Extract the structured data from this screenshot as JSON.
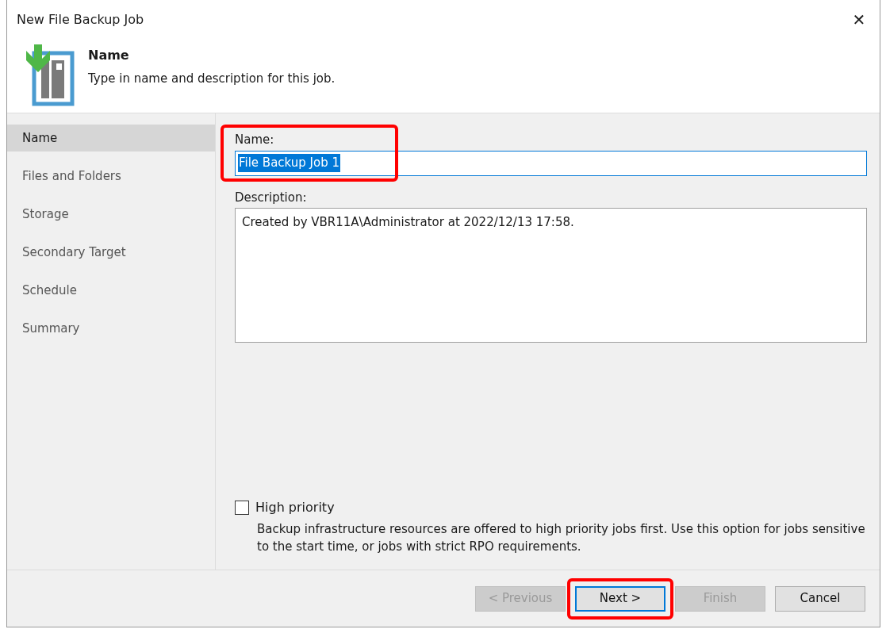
{
  "window": {
    "title": "New File Backup Job",
    "close_glyph": "✕"
  },
  "header": {
    "title": "Name",
    "subtitle": "Type in name and description for this job."
  },
  "steps": [
    {
      "label": "Name",
      "selected": true
    },
    {
      "label": "Files and Folders",
      "selected": false
    },
    {
      "label": "Storage",
      "selected": false
    },
    {
      "label": "Secondary Target",
      "selected": false
    },
    {
      "label": "Schedule",
      "selected": false
    },
    {
      "label": "Summary",
      "selected": false
    }
  ],
  "name_field": {
    "label": "Name:",
    "value": "File Backup Job 1",
    "text_selected": true,
    "highlighted": true
  },
  "description_field": {
    "label": "Description:",
    "value": "Created by VBR11A\\Administrator at 2022/12/13 17:58."
  },
  "high_priority": {
    "label": "High priority",
    "checked": false,
    "note": "Backup infrastructure resources are offered to high priority jobs first. Use this option for jobs sensitive to the start time, or jobs with strict RPO requirements."
  },
  "buttons": [
    {
      "label": "< Previous",
      "disabled": true,
      "default": false,
      "highlighted": false
    },
    {
      "label": "Next >",
      "disabled": false,
      "default": true,
      "highlighted": true
    },
    {
      "label": "Finish",
      "disabled": true,
      "default": false,
      "highlighted": false
    },
    {
      "label": "Cancel",
      "disabled": false,
      "default": false,
      "highlighted": false
    }
  ]
}
